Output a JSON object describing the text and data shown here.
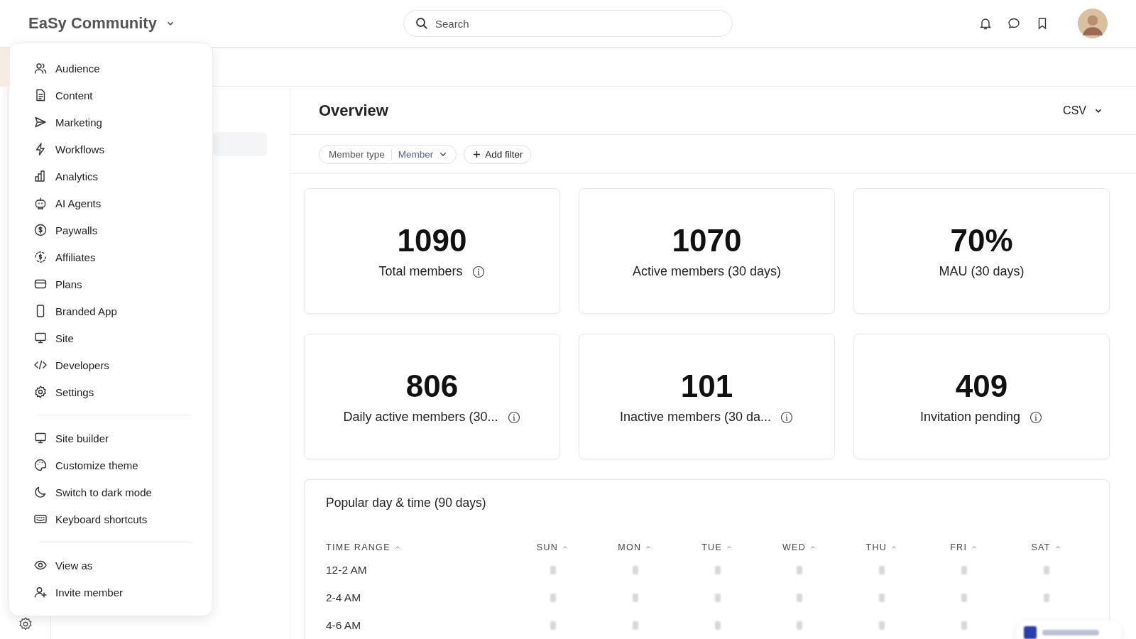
{
  "header": {
    "community": "EaSy Community",
    "search": {
      "placeholder": "Search"
    }
  },
  "menu": {
    "groups": [
      [
        {
          "label": "Audience"
        },
        {
          "label": "Content"
        },
        {
          "label": "Marketing"
        },
        {
          "label": "Workflows"
        },
        {
          "label": "Analytics"
        },
        {
          "label": "AI Agents"
        },
        {
          "label": "Paywalls"
        },
        {
          "label": "Affiliates"
        },
        {
          "label": "Plans"
        },
        {
          "label": "Branded App"
        },
        {
          "label": "Site"
        },
        {
          "label": "Developers"
        },
        {
          "label": "Settings"
        }
      ],
      [
        {
          "label": "Site builder"
        },
        {
          "label": "Customize theme"
        },
        {
          "label": "Switch to dark mode"
        },
        {
          "label": "Keyboard shortcuts"
        }
      ],
      [
        {
          "label": "View as"
        },
        {
          "label": "Invite member"
        }
      ]
    ]
  },
  "overview": {
    "title": "Overview",
    "export": "CSV",
    "filters": [
      {
        "kind": "select",
        "label": "Member type",
        "value": "Member"
      },
      {
        "kind": "add",
        "label": "Add filter"
      }
    ],
    "stats": [
      {
        "value": "1090",
        "label": "Total members",
        "info": true
      },
      {
        "value": "1070",
        "label": "Active members (30 days)",
        "info": false
      },
      {
        "value": "70%",
        "label": "MAU (30 days)",
        "info": false
      },
      {
        "value": "806",
        "label": "Daily active members (30...",
        "info": true
      },
      {
        "value": "101",
        "label": "Inactive members (30 da...",
        "info": true
      },
      {
        "value": "409",
        "label": "Invitation pending",
        "info": true
      }
    ],
    "popular": {
      "title": "Popular day & time (90 days)",
      "columns": [
        "TIME RANGE",
        "SUN",
        "MON",
        "TUE",
        "WED",
        "THU",
        "FRI",
        "SAT"
      ],
      "rows": [
        "12-2 AM",
        "2-4 AM",
        "4-6 AM"
      ]
    }
  }
}
